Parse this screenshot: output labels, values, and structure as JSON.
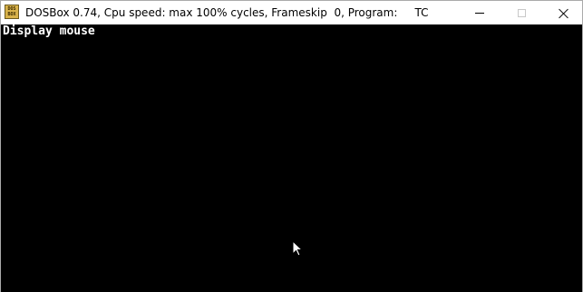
{
  "window": {
    "title": "DOSBox 0.74, Cpu speed: max 100% cycles, Frameskip  0, Program:     TC",
    "icon": "dosbox-icon",
    "icon_text": [
      "DOS",
      "BOX"
    ],
    "controls": {
      "minimize": "minimize-icon",
      "maximize": "maximize-icon",
      "close": "close-icon"
    }
  },
  "console": {
    "lines": [
      "Display mouse"
    ],
    "background": "#000000",
    "foreground": "#ffffff"
  },
  "pointer": {
    "icon": "mouse-cursor-icon"
  }
}
